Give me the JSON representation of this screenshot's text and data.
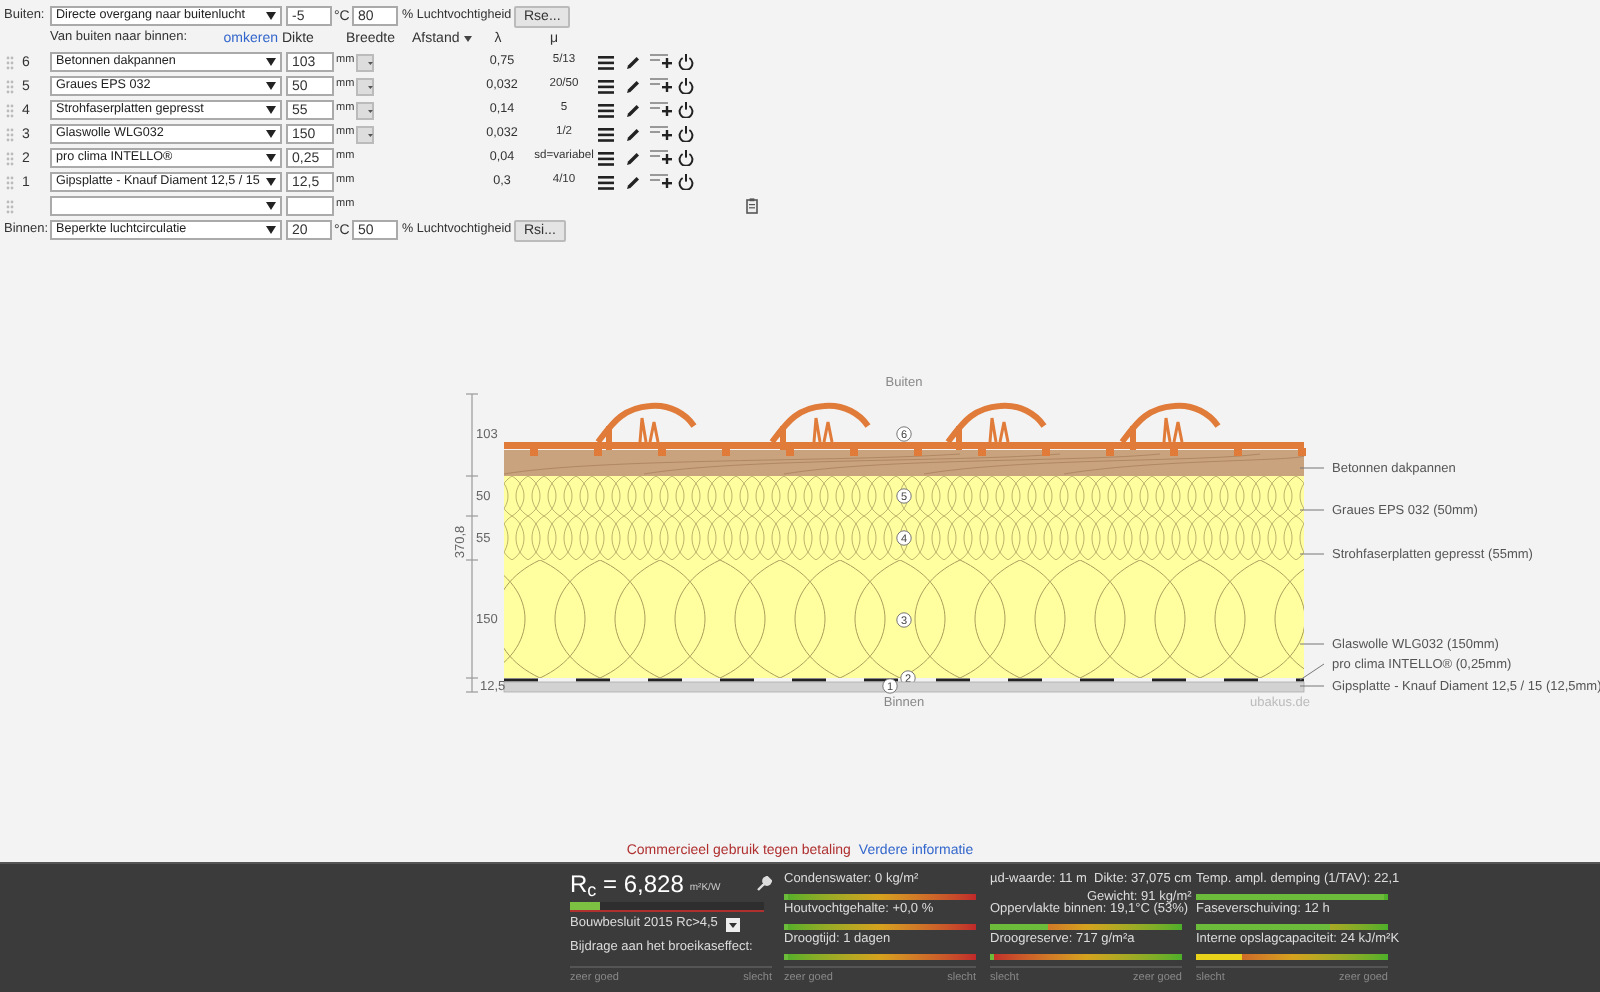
{
  "outside": {
    "label": "Buiten:",
    "climate": "Directe overgang naar buitenlucht",
    "temperature": "-5",
    "temperature_unit": "°C",
    "humidity": "80",
    "humidity_unit": "% Luchtvochtigheid",
    "button": "Rse..."
  },
  "columns": {
    "direction": "Van buiten naar binnen:",
    "reverse_link": "omkeren",
    "thickness": "Dikte",
    "width": "Breedte",
    "distance": "Afstand",
    "lambda": "λ",
    "mu": "μ"
  },
  "layers": [
    {
      "kind": "layer",
      "number": "6",
      "material": "Betonnen dakpannen",
      "thickness": "103",
      "unit": "mm",
      "width_control": true,
      "lambda": "0,75",
      "mu": "5/13"
    },
    {
      "kind": "layer",
      "number": "5",
      "material": "Graues EPS  032",
      "thickness": "50",
      "unit": "mm",
      "width_control": true,
      "lambda": "0,032",
      "mu": "20/50"
    },
    {
      "kind": "layer",
      "number": "4",
      "material": "Strohfaserplatten gepresst",
      "thickness": "55",
      "unit": "mm",
      "width_control": true,
      "lambda": "0,14",
      "mu": "5"
    },
    {
      "kind": "layer",
      "number": "3",
      "material": "Glaswolle WLG032",
      "thickness": "150",
      "unit": "mm",
      "width_control": true,
      "lambda": "0,032",
      "mu": "1/2"
    },
    {
      "kind": "layer",
      "number": "2",
      "material": "pro clima INTELLO®",
      "thickness": "0,25",
      "unit": "mm",
      "width_control": false,
      "lambda": "0,04",
      "mu": "sd=variabel"
    },
    {
      "kind": "layer",
      "number": "1",
      "material": "Gipsplatte - Knauf Diament 12,5 / 15",
      "thickness": "12,5",
      "unit": "mm",
      "width_control": false,
      "lambda": "0,3",
      "mu": "4/10"
    },
    {
      "kind": "empty",
      "unit": "mm"
    }
  ],
  "inside": {
    "label": "Binnen:",
    "climate": "Beperkte luchtcirculatie",
    "temperature": "20",
    "temperature_unit": "°C",
    "humidity": "50",
    "humidity_unit": "% Luchtvochtigheid",
    "button": "Rsi..."
  },
  "drawing": {
    "top_label": "Buiten",
    "bottom_label": "Binnen",
    "total": "370,8",
    "credit": "ubakus.de",
    "layers": [
      {
        "kind": "tiles",
        "number": "6",
        "dimension": "103",
        "callout": "Betonnen dakpannen"
      },
      {
        "kind": "eps",
        "number": "5",
        "dimension": "50",
        "callout": "Graues EPS  032 (50mm)"
      },
      {
        "kind": "fibre",
        "number": "4",
        "dimension": "55",
        "callout": "Strohfaserplatten gepresst (55mm)"
      },
      {
        "kind": "wool",
        "number": "3",
        "dimension": "150",
        "callout": "Glaswolle WLG032 (150mm)"
      },
      {
        "kind": "membrane",
        "number": "2",
        "callout": "pro clima INTELLO® (0,25mm)"
      },
      {
        "kind": "board",
        "number": "1",
        "dimension": "12,5",
        "callout": "Gipsplatte - Knauf Diament 12,5 / 15 (12,5mm)"
      }
    ]
  },
  "notice": {
    "text": "Commercieel gebruik tegen betaling",
    "link": "Verdere informatie"
  },
  "results": {
    "rc": "R$_{c}$ = 6,828",
    "rc_unit": "m²K/W",
    "level": 0.15,
    "standard": "Bouwbesluit 2015 Rc>4,5",
    "greenhouse": "Bijdrage aan het broeikaseffect:",
    "scale_left": "zeer goed",
    "scale_right": "slecht"
  },
  "meter_groups": [
    {
      "kind": "good_left",
      "scale_left": "zeer goed",
      "scale_right": "slecht",
      "meters": [
        {
          "kind": "meter",
          "text": "Condenswater: 0 kg/m²",
          "level": 0.02,
          "color": "#6dbb3a"
        },
        {
          "kind": "meter",
          "text": "Houtvochtgehalte: +0,0 %",
          "level": 0.02,
          "color": "#6dbb3a"
        },
        {
          "kind": "meter",
          "text": "Droogtijd: 1 dagen",
          "level": 0.02,
          "color": "#6dbb3a"
        }
      ]
    },
    {
      "kind": "bad_left",
      "scale_left": "slecht",
      "scale_right": "zeer goed",
      "meters": [
        {
          "kind": "info",
          "text": "µd-waarde: 11 m",
          "notes": [
            "Dikte: 37,075 cm",
            "Gewicht: 91 kg/m²"
          ]
        },
        {
          "kind": "meter",
          "text": "Oppervlakte binnen: 19,1°C (53%)",
          "level": 0.3,
          "color": "#6dbb3a"
        },
        {
          "kind": "meter",
          "text": "Droogreserve: 717 g/m²a",
          "level": 0.02,
          "color": "#6dbb3a"
        }
      ]
    },
    {
      "kind": "bad_left",
      "scale_left": "slecht",
      "scale_right": "zeer goed",
      "meters": [
        {
          "kind": "meter",
          "text": "Temp. ampl. demping (1/TAV): 22,1",
          "level": 0.98,
          "color": "#6dbb3a"
        },
        {
          "kind": "meter",
          "text": "Faseverschuiving: 12 h",
          "level": 0.7,
          "color": "#6dbb3a"
        },
        {
          "kind": "meter",
          "text": "Interne opslagcapaciteit: 24 kJ/m²K",
          "level": 0.24,
          "color": "#e8d21a"
        }
      ]
    }
  ]
}
